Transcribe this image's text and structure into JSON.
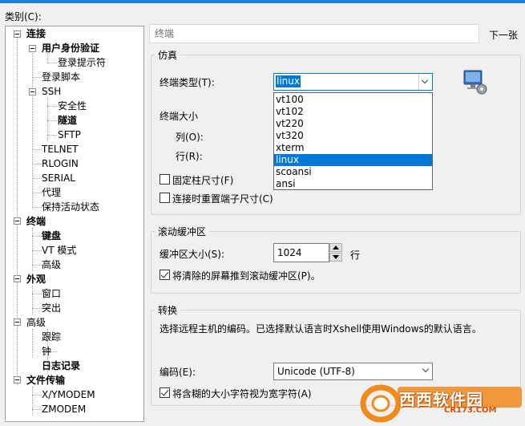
{
  "category_label": "类别(C):",
  "tree": {
    "items": [
      {
        "label": "连接",
        "bold": true
      },
      {
        "label": "用户身份验证",
        "bold": true
      },
      {
        "label": "登录提示符",
        "bold": false
      },
      {
        "label": "登录脚本",
        "bold": false
      },
      {
        "label": "SSH",
        "bold": false
      },
      {
        "label": "安全性",
        "bold": false
      },
      {
        "label": "隧道",
        "bold": true
      },
      {
        "label": "SFTP",
        "bold": false
      },
      {
        "label": "TELNET",
        "bold": false
      },
      {
        "label": "RLOGIN",
        "bold": false
      },
      {
        "label": "SERIAL",
        "bold": false
      },
      {
        "label": "代理",
        "bold": false
      },
      {
        "label": "保持活动状态",
        "bold": false
      },
      {
        "label": "终端",
        "bold": true
      },
      {
        "label": "键盘",
        "bold": true
      },
      {
        "label": "VT 模式",
        "bold": false
      },
      {
        "label": "高级",
        "bold": false
      },
      {
        "label": "外观",
        "bold": true
      },
      {
        "label": "窗口",
        "bold": false
      },
      {
        "label": "突出",
        "bold": false
      },
      {
        "label": "高级",
        "bold": false
      },
      {
        "label": "跟踪",
        "bold": false
      },
      {
        "label": "钟",
        "bold": false
      },
      {
        "label": "日志记录",
        "bold": true
      },
      {
        "label": "文件传输",
        "bold": true
      },
      {
        "label": "X/YMODEM",
        "bold": false
      },
      {
        "label": "ZMODEM",
        "bold": false
      }
    ]
  },
  "header": {
    "section_title": "终端",
    "next_button": "下一张"
  },
  "emulation": {
    "group_title": "仿真",
    "terminal_type_label": "终端类型(T):",
    "terminal_type_value": "linux",
    "options": [
      "vt100",
      "vt102",
      "vt220",
      "vt320",
      "xterm",
      "linux",
      "scoansi",
      "ansi"
    ],
    "selected_option": "linux",
    "terminal_size_label": "终端大小",
    "columns_label": "列(O):",
    "rows_label": "行(R):",
    "fixed_size_label": "固定柱尺寸(F)",
    "fixed_size_checked": false,
    "reset_size_label": "连接时重置端子尺寸(C)",
    "reset_size_checked": false
  },
  "scroll_buffer": {
    "group_title": "滚动缓冲区",
    "size_label": "缓冲区大小(S):",
    "size_value": "1024",
    "unit": "行",
    "push_label": "将清除的屏幕推到滚动缓冲区(P)。",
    "push_checked": true
  },
  "conversion": {
    "group_title": "转换",
    "description": "选择远程主机的编码。已选择默认语言时Xshell使用Windows的默认语言。",
    "encoding_label": "编码(E):",
    "encoding_value": "Unicode (UTF-8)",
    "ambiguous_label": "将含糊的大小字符视为宽字符(A)",
    "ambiguous_checked": true
  },
  "watermark": {
    "text": "西西软件园",
    "url": "CR173.COM"
  },
  "colors": {
    "accent": "#0078d7",
    "topbar": "#1c7fd6",
    "panel_bg": "#f0f0f0"
  }
}
